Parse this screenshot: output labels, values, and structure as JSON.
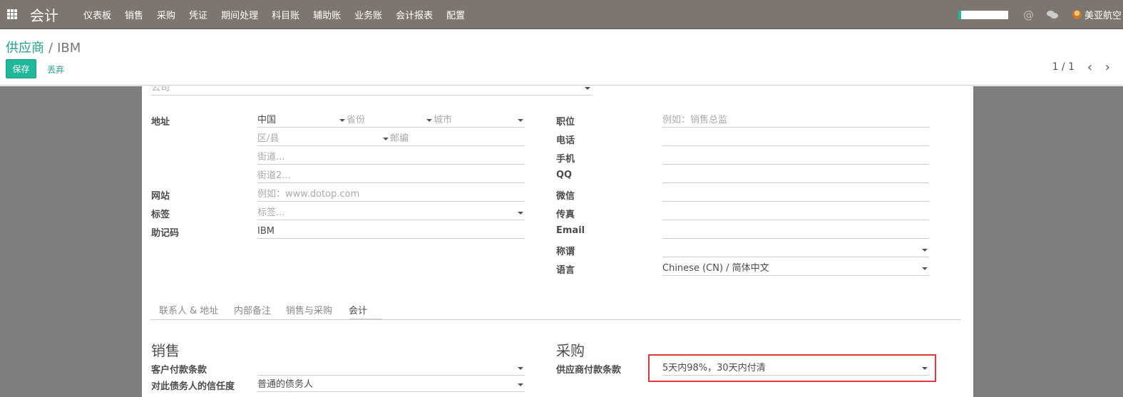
{
  "navbar": {
    "brand": "会计",
    "menu": [
      "仪表板",
      "销售",
      "采购",
      "凭证",
      "期间处理",
      "科目账",
      "辅助账",
      "业务账",
      "会计报表",
      "配置"
    ],
    "at_symbol": "@",
    "user": "美亚航空",
    "accent_color": "#21b799"
  },
  "control_panel": {
    "breadcrumb_parent": "供应商",
    "breadcrumb_sep": "/",
    "breadcrumb_current": "IBM",
    "save_label": "保存",
    "discard_label": "丢弃",
    "pager": "1 / 1",
    "prev_symbol": "‹",
    "next_symbol": "›"
  },
  "form": {
    "company_placeholder": "公司",
    "address_label": "地址",
    "country_value": "中国",
    "province_placeholder": "省份",
    "city_placeholder": "城市",
    "district_placeholder": "区/县",
    "zip_placeholder": "邮编",
    "street_placeholder": "街道...",
    "street2_placeholder": "街道2...",
    "website_label": "网站",
    "website_placeholder": "例如：www.dotop.com",
    "tags_label": "标签",
    "tags_placeholder": "标签...",
    "ref_label": "助记码",
    "ref_value": "IBM",
    "job_label": "职位",
    "job_placeholder": "例如：销售总监",
    "phone_label": "电话",
    "mobile_label": "手机",
    "qq_label": "QQ",
    "wechat_label": "微信",
    "fax_label": "传真",
    "email_label": "Email",
    "title_label": "称谓",
    "lang_label": "语言",
    "lang_value": "Chinese (CN) / 简体中文"
  },
  "tabs": [
    "联系人 & 地址",
    "内部备注",
    "销售与采购",
    "会计"
  ],
  "sales": {
    "heading": "销售",
    "customer_terms_label": "客户付款条款",
    "trust_label": "对此债务人的信任度",
    "trust_value": "普通的债务人"
  },
  "purchase": {
    "heading": "采购",
    "vendor_terms_label": "供应商付款条款",
    "vendor_terms_value": "5天内98%，30天内付清",
    "highlight_color": "#e0383b"
  }
}
